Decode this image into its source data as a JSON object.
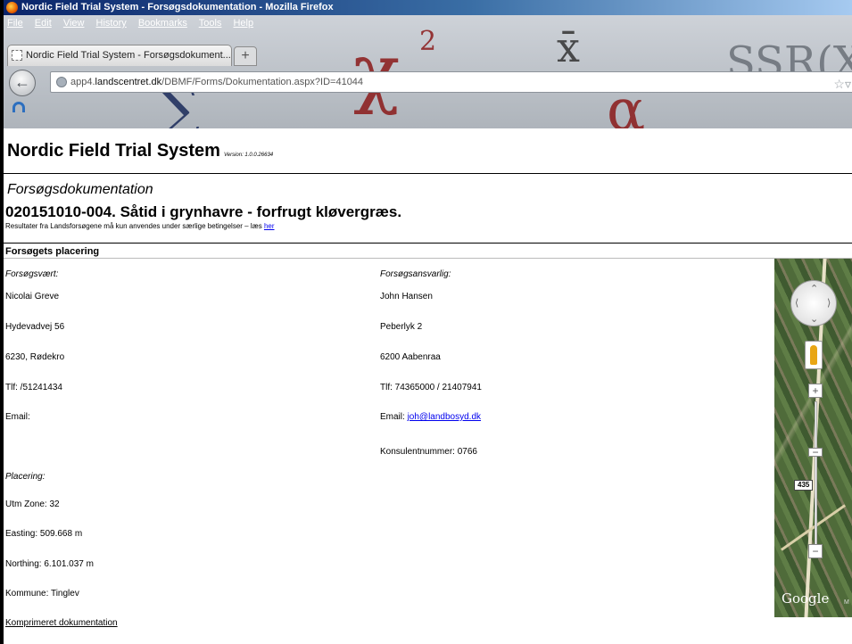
{
  "window": {
    "title": "Nordic Field Trial System - Forsøgsdokumentation - Mozilla Firefox",
    "menu": [
      "File",
      "Edit",
      "View",
      "History",
      "Bookmarks",
      "Tools",
      "Help"
    ]
  },
  "tab": {
    "label": "Nordic Field Trial System - Forsøgsdokument...",
    "new_tab_label": "+"
  },
  "addressbar": {
    "prefix": "app4.",
    "domain": "landscentret.dk",
    "path": "/DBMF/Forms/Dokumentation.aspx?ID=41044"
  },
  "header": {
    "system_title": "Nordic Field Trial System",
    "version": "Version: 1.0.0.26634"
  },
  "document": {
    "heading": "Forsøgsdokumentation",
    "trial_title": "020151010-004. Såtid i grynhavre - forfrugt kløvergræs.",
    "notice_text": "Resultater fra Landsforsøgene må kun anvendes under særlige betingelser – læs",
    "notice_link": "her",
    "section_heading": "Forsøgets placering"
  },
  "host": {
    "label": "Forsøgsvært:",
    "name": "Nicolai Greve",
    "address": "Hydevadvej 56",
    "city": "6230, Rødekro",
    "phone": "Tlf: /51241434",
    "email_label": "Email:"
  },
  "responsible": {
    "label": "Forsøgsansvarlig:",
    "name": "John Hansen",
    "address": "Peberlyk 2",
    "city": "6200 Aabenraa",
    "phone": "Tlf: 74365000 / 21407941",
    "email_label": "Email:",
    "email": "joh@landbosyd.dk",
    "consultant": "Konsulentnummer: 0766"
  },
  "placement": {
    "label": "Placering:",
    "utm_zone": "Utm Zone: 32",
    "easting": "Easting: 509.668 m",
    "northing": "Northing: 6.101.037 m",
    "kommune": "Kommune: Tinglev"
  },
  "footer": {
    "compressed_link": "Komprimeret dokumentation"
  },
  "map": {
    "route_number": "435",
    "zoom_in": "+",
    "zoom_out": "−",
    "logo": "Google",
    "terms": "M"
  },
  "colors": {
    "link": "#0000ee",
    "titlebar": "#0a246a"
  }
}
